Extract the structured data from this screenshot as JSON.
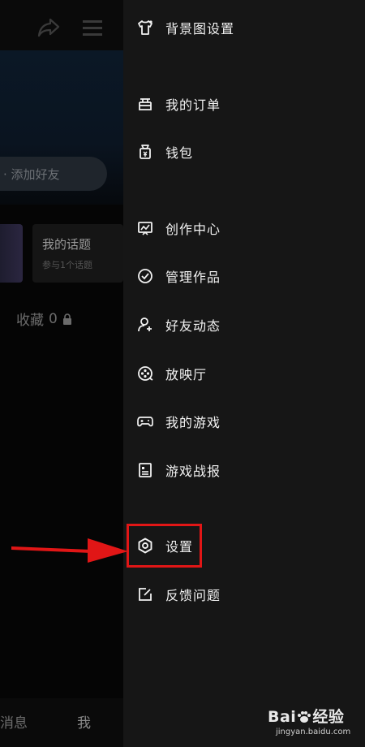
{
  "background_page": {
    "add_friend_label": "· 添加好友",
    "topic_card": {
      "title": "我的话题",
      "subtitle": "参与1个话题"
    },
    "favorites": {
      "label": "收藏",
      "count": "0"
    },
    "bottom_tabs": {
      "messages": "消息",
      "me": "我"
    }
  },
  "drawer": {
    "items": [
      {
        "label": "背景图设置",
        "icon": "tshirt-icon"
      },
      {
        "label": "我的订单",
        "icon": "order-icon"
      },
      {
        "label": "钱包",
        "icon": "wallet-icon"
      },
      {
        "label": "创作中心",
        "icon": "creator-icon"
      },
      {
        "label": "管理作品",
        "icon": "check-circle-icon"
      },
      {
        "label": "好友动态",
        "icon": "friend-activity-icon"
      },
      {
        "label": "放映厅",
        "icon": "film-reel-icon"
      },
      {
        "label": "我的游戏",
        "icon": "gamepad-icon"
      },
      {
        "label": "游戏战报",
        "icon": "report-icon"
      },
      {
        "label": "设置",
        "icon": "settings-hexagon-icon"
      },
      {
        "label": "反馈问题",
        "icon": "feedback-edit-icon"
      }
    ]
  },
  "annotation": {
    "highlight_color": "#e11616",
    "highlighted_item": "设置"
  },
  "watermark": {
    "brand_left": "Bai",
    "brand_right": "经验",
    "url": "jingyan.baidu.com"
  },
  "colors": {
    "drawer_bg": "#161616",
    "page_bg": "#050505",
    "text": "#f2f2f2"
  }
}
